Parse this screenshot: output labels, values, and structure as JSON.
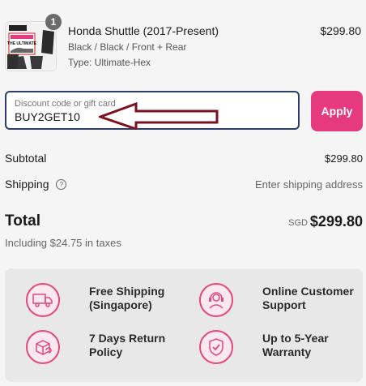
{
  "product": {
    "quantity": "1",
    "name": "Honda Shuttle (2017-Present)",
    "variant": "Black / Black / Front + Rear",
    "type": "Type: Ultimate-Hex",
    "price": "$299.80",
    "thumb_text": "THE ULTIMATE"
  },
  "discount": {
    "label": "Discount code or gift card",
    "value": "BUY2GET10",
    "apply_label": "Apply"
  },
  "summary": {
    "subtotal_label": "Subtotal",
    "subtotal_value": "$299.80",
    "shipping_label": "Shipping",
    "shipping_value": "Enter shipping address",
    "help_glyph": "?",
    "total_label": "Total",
    "total_currency": "SGD",
    "total_amount": "$299.80",
    "tax_line": "Including $24.75 in taxes"
  },
  "features": [
    {
      "icon": "free-shipping-truck-icon",
      "text": "Free Shipping (Singapore)"
    },
    {
      "icon": "customer-support-headset-icon",
      "text": "Online Customer Support"
    },
    {
      "icon": "return-box-icon",
      "text": "7 Days Return Policy"
    },
    {
      "icon": "warranty-shield-icon",
      "text": "Up to 5-Year Warranty"
    }
  ],
  "colors": {
    "accent": "#e53a7d",
    "input_border": "#2a3d6b",
    "arrow": "#7a1020"
  }
}
